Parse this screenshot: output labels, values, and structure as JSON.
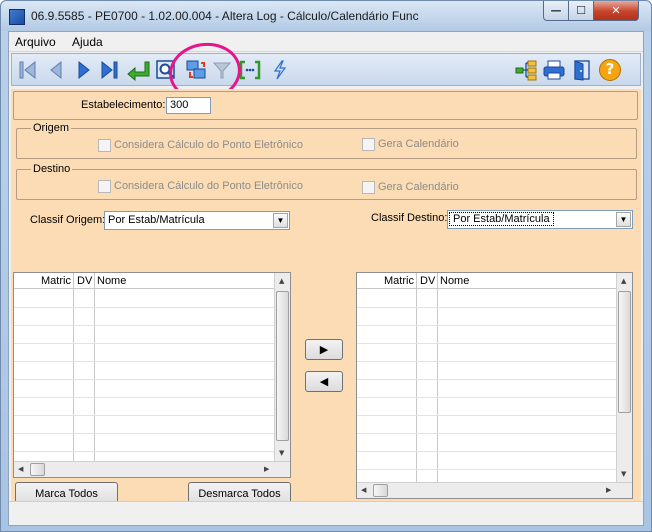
{
  "window": {
    "title": "06.9.5585 - PE0700 - 1.02.00.004 - Altera Log - Cálculo/Calendário Func",
    "minimize_glyph": "—",
    "maximize_glyph": "☐",
    "close_glyph": "✕"
  },
  "menu": {
    "items": [
      {
        "label": "Arquivo"
      },
      {
        "label": "Ajuda"
      }
    ]
  },
  "toolbar": {
    "icons": [
      "first-record-icon",
      "previous-record-icon",
      "next-record-icon",
      "last-record-icon",
      "confirm-icon",
      "zoom-icon",
      "copy-records-icon",
      "filter-icon",
      "brackets-icon",
      "lightning-icon",
      "tree-icon",
      "print-icon",
      "exit-icon",
      "help-icon"
    ],
    "help_glyph": "?",
    "annotation_color": "#e8148c"
  },
  "form": {
    "estabelecimento_label": "Estabelecimento:",
    "estabelecimento_value": "300",
    "origem": {
      "title": "Origem",
      "considera_label": "Considera Cálculo do Ponto Eletrônico",
      "gera_label": "Gera Calendário"
    },
    "destino": {
      "title": "Destino",
      "considera_label": "Considera Cálculo do Ponto Eletrônico",
      "gera_label": "Gera Calendário"
    },
    "classif_origem_label": "Classif Origem:",
    "classif_origem_value": "Por Estab/Matrícula",
    "classif_destino_label": "Classif Destino:",
    "classif_destino_value": "Por Estab/Matrícula",
    "grid_left": {
      "columns": [
        "Matric",
        "DV",
        "Nome"
      ]
    },
    "grid_right": {
      "columns": [
        "Matric",
        "DV",
        "Nome"
      ]
    },
    "move_right_glyph": "▶",
    "move_left_glyph": "◀",
    "marca_todos_label": "Marca Todos",
    "desmarca_todos_label": "Desmarca Todos"
  },
  "colors": {
    "panel_bg": "#fcdcb4",
    "toolbar_blue": "#2e6fd1"
  }
}
